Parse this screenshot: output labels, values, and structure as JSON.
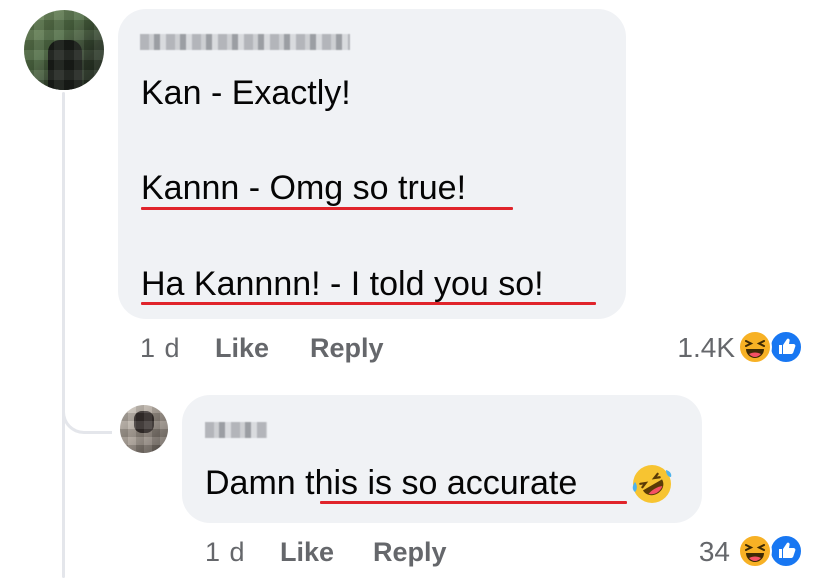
{
  "comment": {
    "lines": [
      "Kan - Exactly!",
      "Kannn - Omg so true!",
      "Ha Kannnn! - I told you so!"
    ],
    "time": "1 d",
    "like_label": "Like",
    "reply_label": "Reply",
    "reaction_count": "1.4K",
    "reactions": [
      "haha-icon",
      "like-icon"
    ]
  },
  "reply": {
    "text": "Damn this is so accurate",
    "emoji": "rolling-on-floor-laughing-icon",
    "time": "1 d",
    "like_label": "Like",
    "reply_label": "Reply",
    "reaction_count": "34",
    "reactions": [
      "haha-icon",
      "like-icon"
    ]
  },
  "colors": {
    "bubble": "#f0f2f5",
    "meta_text": "#65676b",
    "spellcheck_underline": "#e0242b",
    "like_blue": "#1877f2",
    "haha_yellow": "#f7b125"
  }
}
